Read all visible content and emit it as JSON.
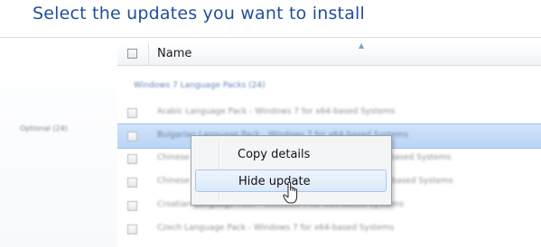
{
  "heading": "Select the updates you want to install",
  "sidebar": {
    "items": [
      {
        "label": "Optional (24)"
      }
    ]
  },
  "list": {
    "column_header": "Name",
    "group": "Windows 7 Language Packs (24)",
    "rows": [
      {
        "text": "Arabic Language Pack - Windows 7 for x64-based Systems",
        "selected": false
      },
      {
        "text": "Bulgarian Language Pack - Windows 7 for x64-based Systems",
        "selected": true
      },
      {
        "text": "Chinese (Simplified) Language Pack - Windows 7 for x64-based Systems",
        "selected": false
      },
      {
        "text": "Chinese (Traditional) Language Pack - Windows 7 for x64-based Systems",
        "selected": false
      },
      {
        "text": "Croatian Language Pack - Windows 7 for x64-based Systems",
        "selected": false
      },
      {
        "text": "Czech Language Pack - Windows 7 for x64-based Systems",
        "selected": false
      }
    ]
  },
  "context_menu": {
    "items": [
      {
        "label": "Copy details"
      },
      {
        "label": "Hide update"
      }
    ]
  },
  "colors": {
    "heading": "#1e4f9c",
    "selection": "#b9d5f6",
    "menu_hover": "#dbe9f9"
  }
}
